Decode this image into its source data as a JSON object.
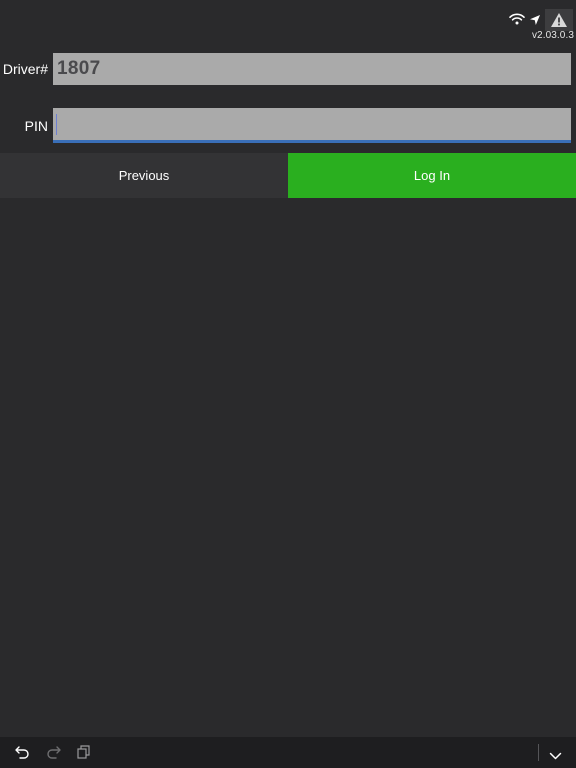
{
  "status": {
    "version": "v2.03.0.3",
    "icons": [
      "wifi-icon",
      "location-arrow-icon",
      "warning-icon"
    ]
  },
  "form": {
    "driver": {
      "label": "Driver#",
      "value": "1807"
    },
    "pin": {
      "label": "PIN",
      "value": ""
    }
  },
  "buttons": {
    "previous": "Previous",
    "login": "Log In"
  },
  "toolbar": {
    "icons": [
      "undo-icon",
      "redo-icon",
      "copy-icon",
      "chevron-down-icon"
    ]
  },
  "colors": {
    "background": "#2a2a2c",
    "input_background": "#aaaaaa",
    "login_button": "#2aaf1f",
    "previous_button": "#333335",
    "focus_underline": "#3a6fb8"
  }
}
